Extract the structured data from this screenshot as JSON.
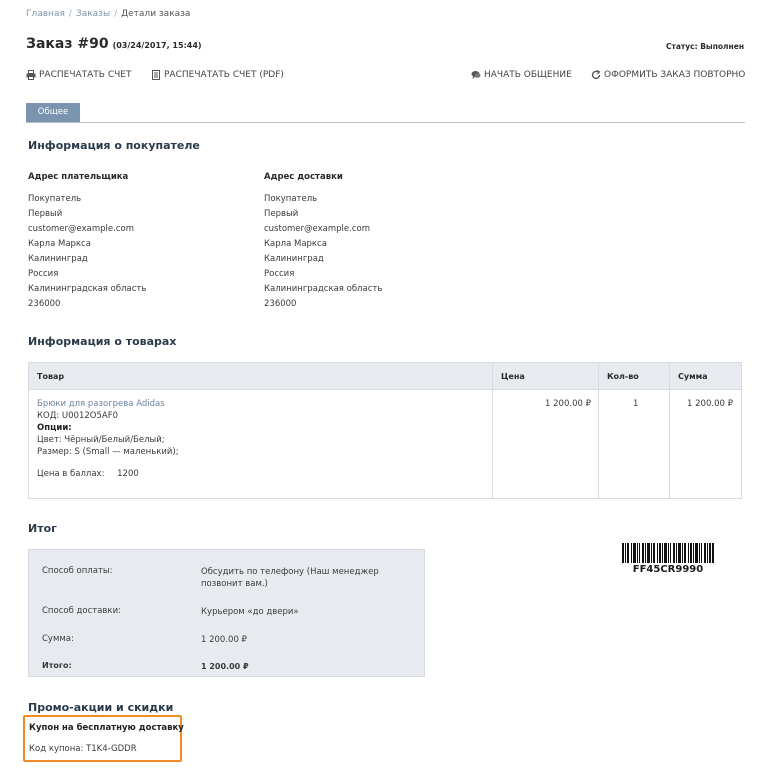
{
  "breadcrumb": {
    "home": "Главная",
    "sep1": "/",
    "orders": "Заказы",
    "sep2": "/",
    "current": "Детали заказа"
  },
  "header": {
    "title": "Заказ #90",
    "date": "(03/24/2017, 15:44)",
    "status": "Статус: Выполнен"
  },
  "actions": {
    "print": "РАСПЕЧАТАТЬ СЧЕТ",
    "print_pdf": "РАСПЕЧАТАТЬ СЧЕТ (PDF)",
    "chat": "НАЧАТЬ ОБЩЕНИЕ",
    "reorder": "ОФОРМИТЬ ЗАКАЗ ПОВТОРНО"
  },
  "tabs": [
    {
      "label": "Общее"
    }
  ],
  "customer": {
    "heading": "Информация о покупателе",
    "billing": {
      "heading": "Адрес плательщика",
      "lines": [
        "Покупатель",
        "Первый",
        "customer@example.com",
        "Карла Маркса",
        "Калининград",
        "Россия",
        "Калининградская область",
        "236000"
      ]
    },
    "shipping": {
      "heading": "Адрес доставки",
      "lines": [
        "Покупатель",
        "Первый",
        "customer@example.com",
        "Карла Маркса",
        "Калининград",
        "Россия",
        "Калининградская область",
        "236000"
      ]
    }
  },
  "products": {
    "heading": "Информация о товарах",
    "columns": {
      "product": "Товар",
      "price": "Цена",
      "qty": "Кол-во",
      "total": "Сумма"
    },
    "rows": [
      {
        "name": "Брюки для разогрева Adidas",
        "code": "КОД: U0012O5AF0",
        "options_label": "Опции:",
        "option1": "Цвет: Чёрный/Белый/Белый;",
        "option2": "Размер: S (Small — маленький);",
        "points_label": "Цена в баллах:",
        "points_value": "1200",
        "price": "1 200.00 ₽",
        "qty": "1",
        "total": "1 200.00 ₽"
      }
    ]
  },
  "summary": {
    "heading": "Итог",
    "payment_label": "Способ оплаты:",
    "payment_value": "Обсудить по телефону (Наш менеджер позвонит вам.)",
    "shipping_label": "Способ доставки:",
    "shipping_value": "Курьером «до двери»",
    "subtotal_label": "Сумма:",
    "subtotal_value": "1 200.00 ₽",
    "total_label": "Итого:",
    "total_value": "1 200.00 ₽"
  },
  "barcode": {
    "text": "FF45CR9990"
  },
  "promo": {
    "heading": "Промо-акции и скидки",
    "coupon_title": "Купон на бесплатную доставку",
    "coupon_code": "Код купона: T1K4-GDDR"
  },
  "colors": {
    "tab": "#7a93ae",
    "highlight": "#f08a24",
    "panel": "#e7ebef"
  }
}
